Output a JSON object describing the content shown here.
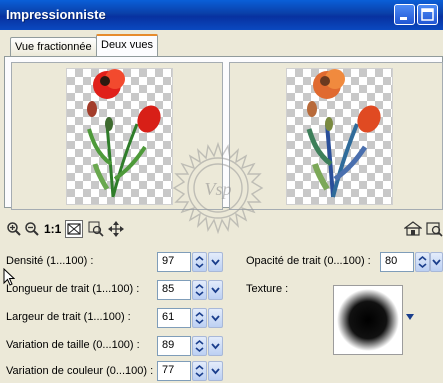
{
  "window": {
    "title": "Impressionniste"
  },
  "tabs": [
    {
      "label": "Vue fractionnée",
      "active": false
    },
    {
      "label": "Deux vues",
      "active": true
    }
  ],
  "toolbar": {
    "zoom_level": "1:1",
    "icons": [
      "zoom-in-icon",
      "zoom-out-icon",
      "zoom-fit-icon",
      "reset-zoom-icon",
      "pan-icon",
      "move-icon",
      "link-views-icon",
      "preview-icon"
    ]
  },
  "watermark": {
    "text": "Vsp"
  },
  "settings": {
    "densite": {
      "label": "Densité (1...100) :",
      "value": "97"
    },
    "longueur": {
      "label": "Longueur de trait (1...100) :",
      "value": "85"
    },
    "largeur": {
      "label": "Largeur de trait (1...100) :",
      "value": "61"
    },
    "var_taille": {
      "label": "Variation de taille (0...100) :",
      "value": "89"
    },
    "var_couleur": {
      "label": "Variation de couleur (0...100) :",
      "value": "77"
    },
    "opacite": {
      "label": "Opacité de trait (0...100) :",
      "value": "80"
    },
    "texture": {
      "label": "Texture :"
    }
  },
  "colors": {
    "titlebar": "#0a49c0",
    "tab_active_accent": "#e68b2c",
    "flower_red": "#e0201a"
  }
}
